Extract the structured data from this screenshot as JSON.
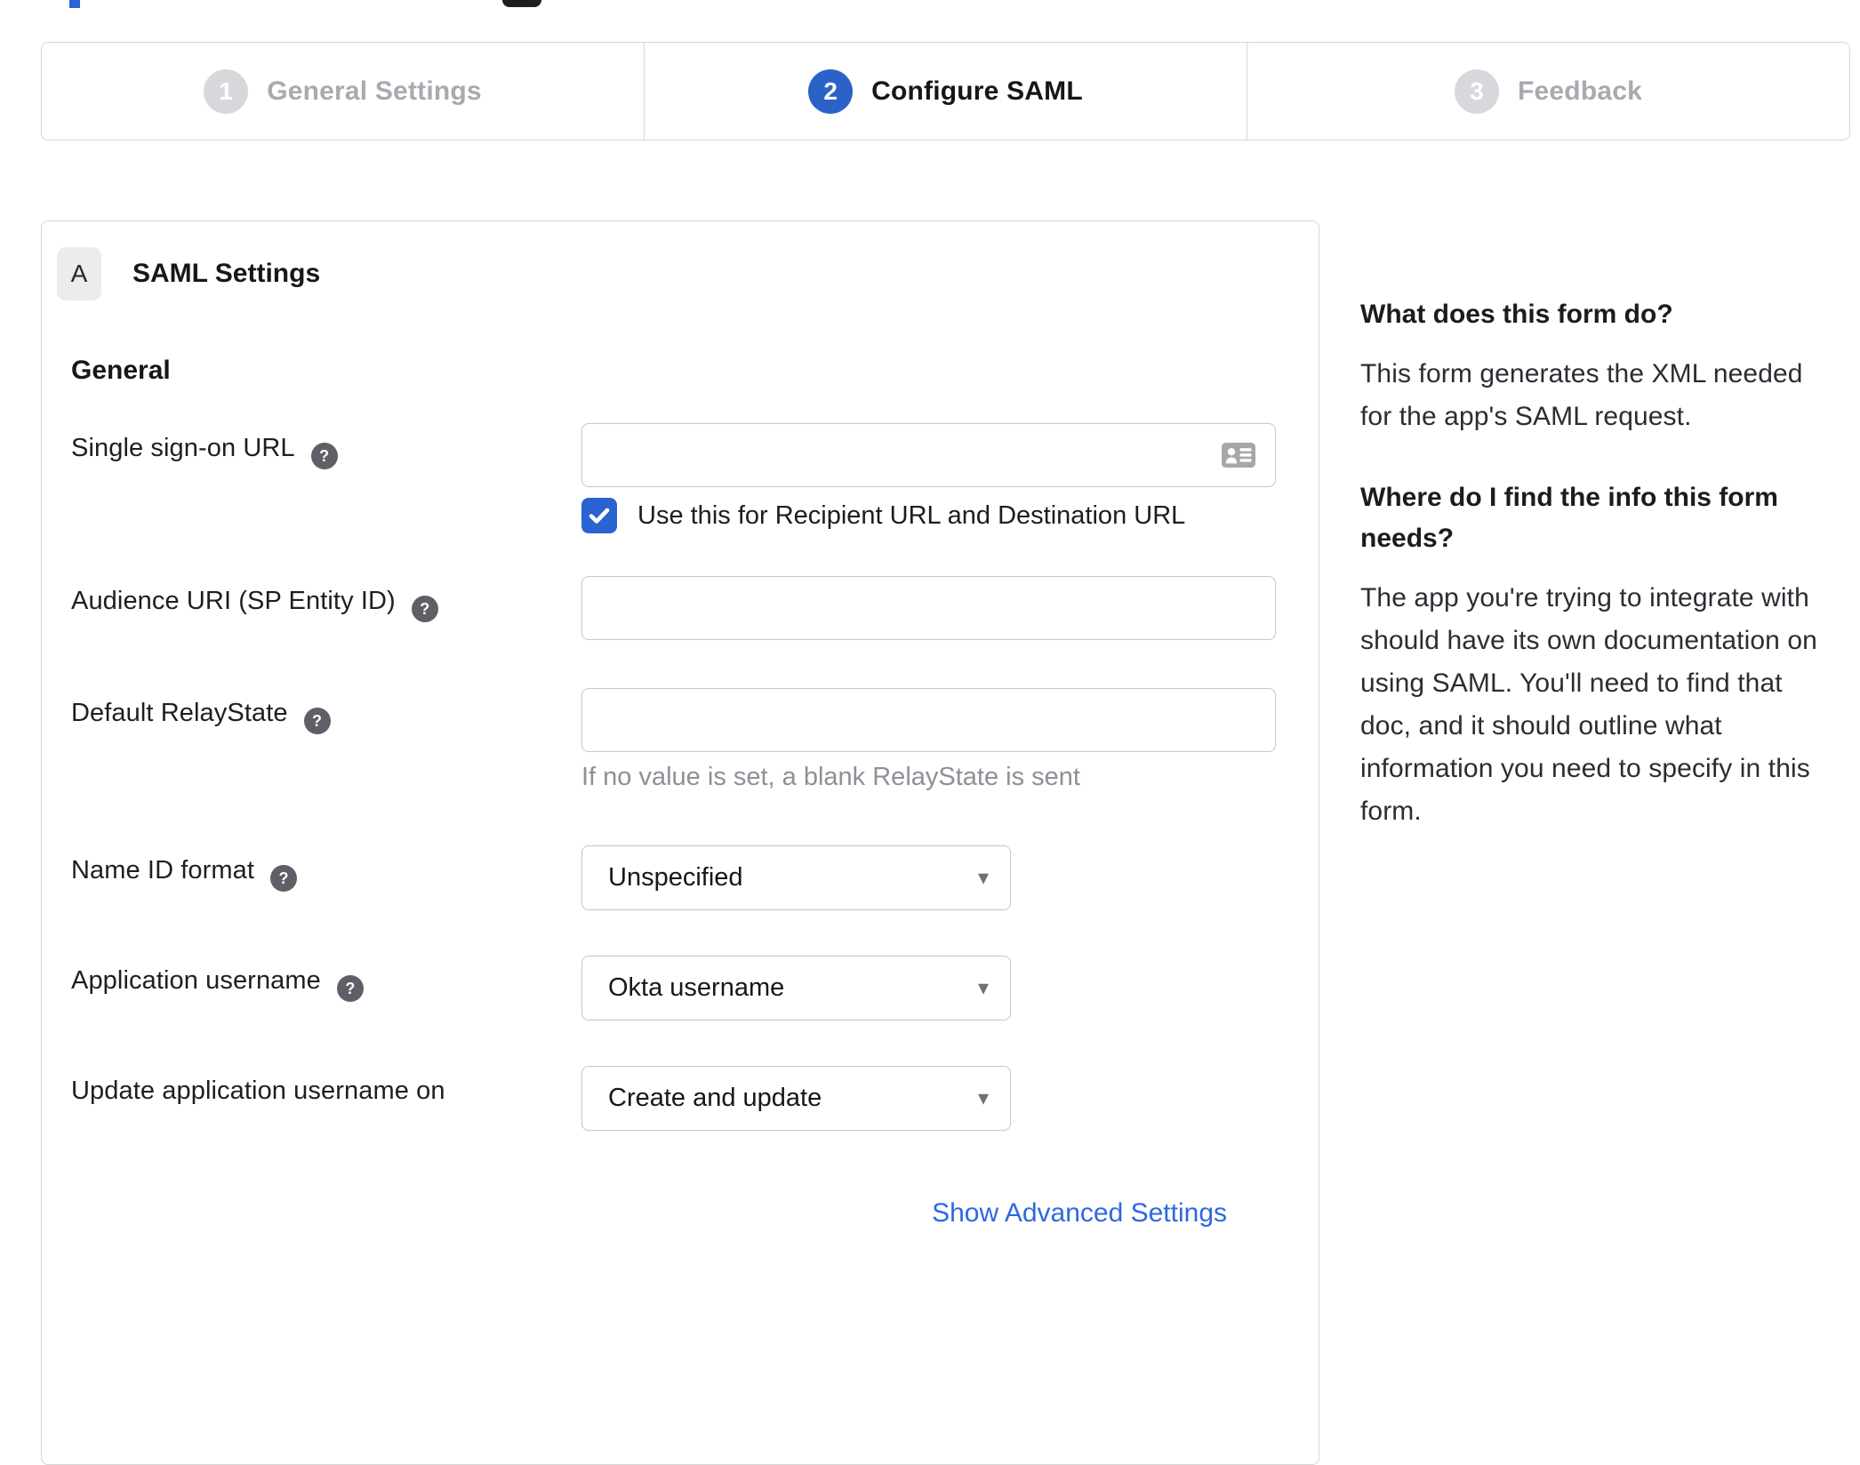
{
  "stepper": {
    "steps": [
      {
        "number": "1",
        "label": "General Settings",
        "active": false
      },
      {
        "number": "2",
        "label": "Configure SAML",
        "active": true
      },
      {
        "number": "3",
        "label": "Feedback",
        "active": false
      }
    ]
  },
  "panel": {
    "badge": "A",
    "title": "SAML Settings",
    "group_heading": "General",
    "rows": {
      "sso": {
        "label": "Single sign-on URL",
        "value": "",
        "checkbox_checked": true,
        "checkbox_label": "Use this for Recipient URL and Destination URL"
      },
      "audience": {
        "label": "Audience URI (SP Entity ID)",
        "value": ""
      },
      "relay": {
        "label": "Default RelayState",
        "value": "",
        "hint": "If no value is set, a blank RelayState is sent"
      },
      "nameid": {
        "label": "Name ID format",
        "value": "Unspecified"
      },
      "appuser": {
        "label": "Application username",
        "value": "Okta username"
      },
      "updateuser": {
        "label": "Update application username on",
        "value": "Create and update"
      }
    },
    "advanced_link": "Show Advanced Settings"
  },
  "sidebar": {
    "sections": [
      {
        "heading": "What does this form do?",
        "body": "This form generates the XML needed for the app's SAML request."
      },
      {
        "heading": "Where do I find the info this form needs?",
        "body": "The app you're trying to integrate with should have its own documentation on using SAML. You'll need to find that doc, and it should outline what information you need to specify in this form."
      }
    ]
  },
  "icons": {
    "help": "?",
    "dropdown_caret": "▾"
  },
  "colors": {
    "accent_blue": "#2a63d2",
    "step_active_blue": "#2b62c8",
    "link_blue": "#2e68e0",
    "border_gray": "#d6d6da",
    "input_border_gray": "#c7c7cc",
    "inactive_gray": "#a9a9b0",
    "hint_gray": "#8f8f97"
  }
}
